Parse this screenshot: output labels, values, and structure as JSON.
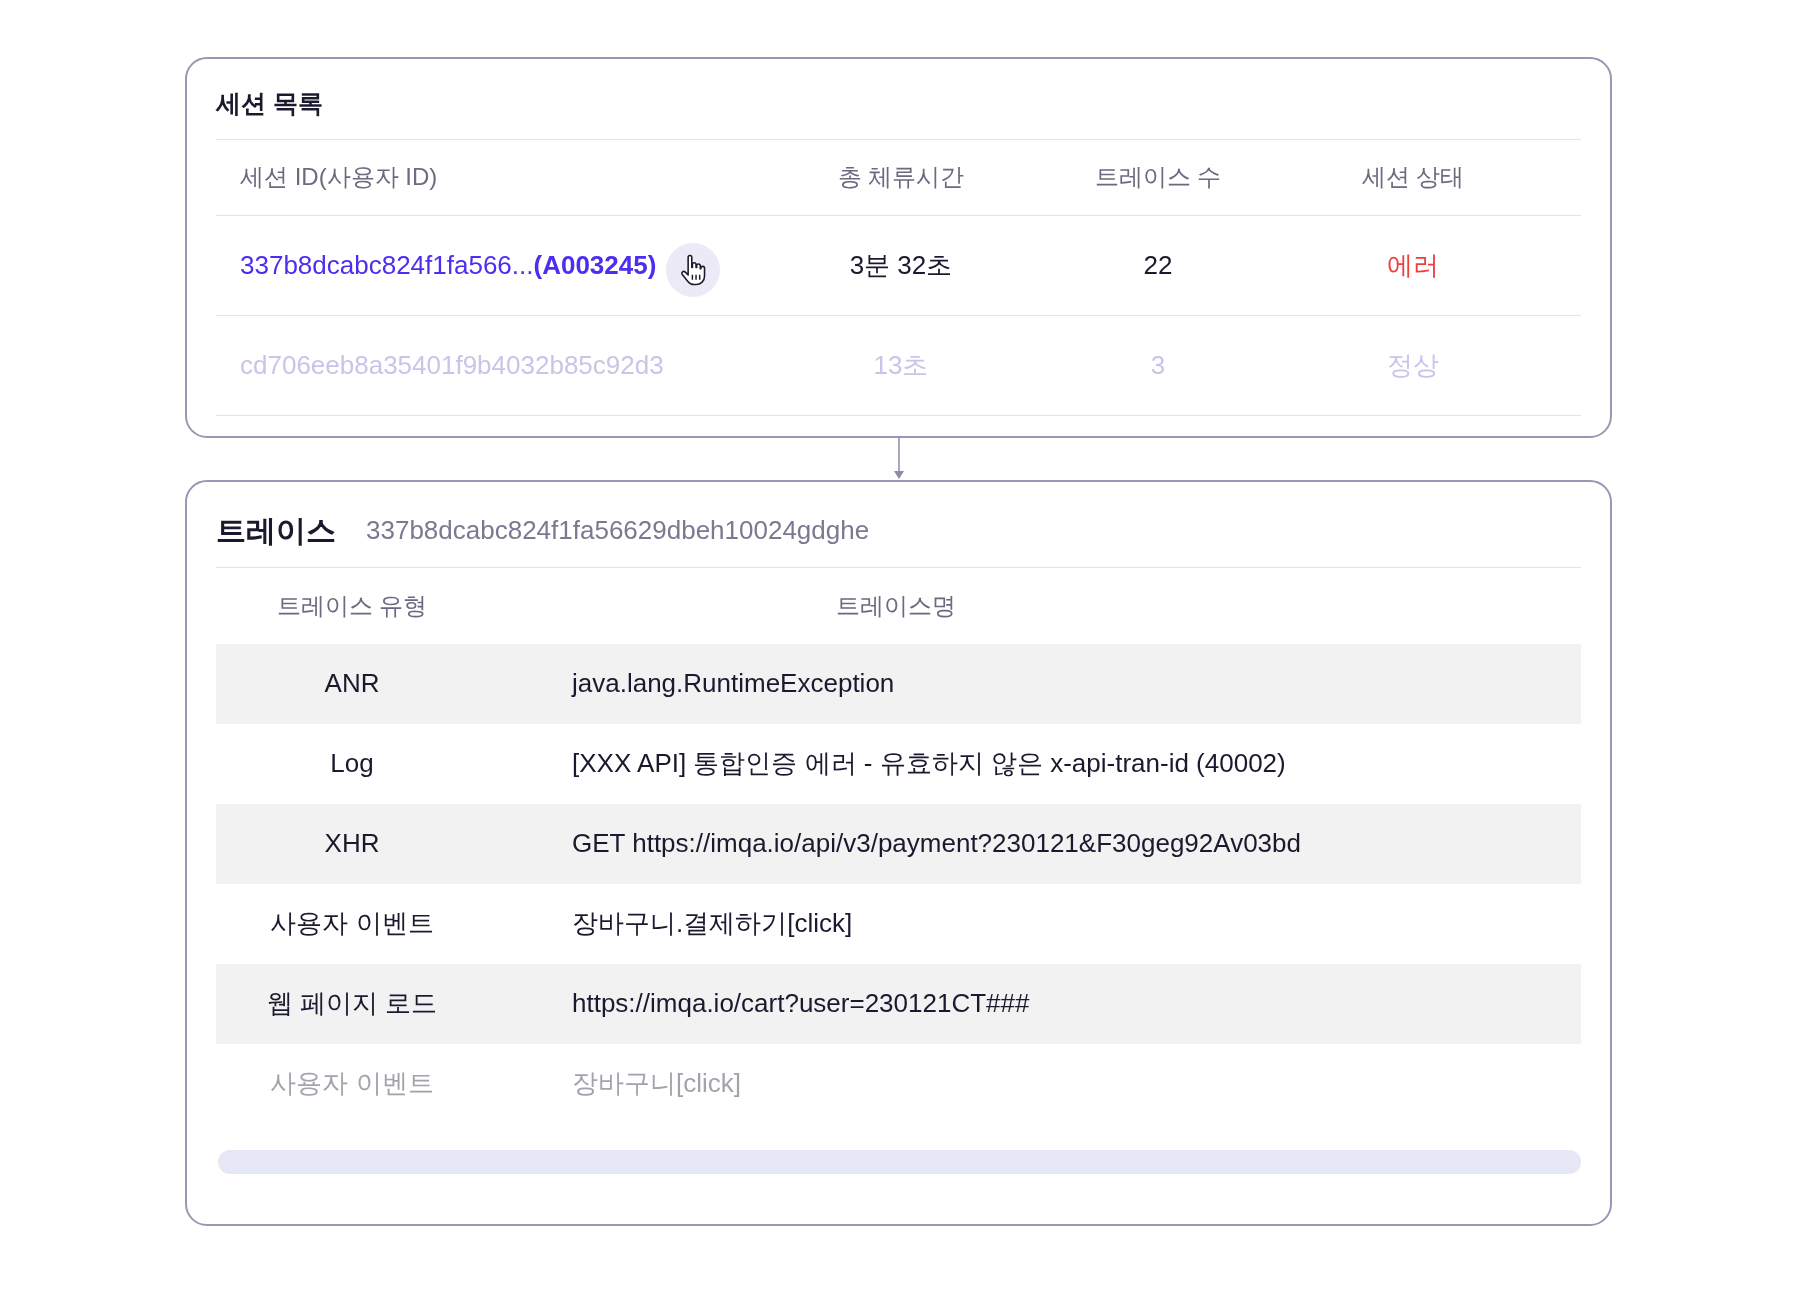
{
  "sessions": {
    "title": "세션 목록",
    "columns": [
      "세션 ID(사용자 ID)",
      "총 체류시간",
      "트레이스 수",
      "세션 상태"
    ],
    "rows": [
      {
        "session_id": "337b8dcabc824f1fa566...**(A003245)**",
        "duration": "3분 32초",
        "trace_count": "22",
        "status": "에러",
        "color": "#f03e3e",
        "selected": true
      },
      {
        "session_id": "cd706eeb8a35401f9b4032b85c92d3",
        "duration": "13초",
        "trace_count": "3",
        "status": "정상",
        "color": "#c9c4e8",
        "selected": false
      }
    ]
  },
  "traces": {
    "title": "트레이스",
    "trace_id": "337b8dcabc824f1fa56629dbeh10024gdghe",
    "columns": [
      "트레이스 유형",
      "트레이스명"
    ],
    "rows": [
      {
        "type": "ANR",
        "name": "java.lang.RuntimeException",
        "dimmed": false
      },
      {
        "type": "Log",
        "name": "[XXX API] 통합인증 에러 - 유효하지 않은 x-api-tran-id (40002)",
        "dimmed": false
      },
      {
        "type": "XHR",
        "name": "GET https://imqa.io/api/v3/payment?230121&F30geg92Av03bd",
        "dimmed": false
      },
      {
        "type": "사용자 이벤트",
        "name": "장바구니.결제하기[click]",
        "dimmed": false
      },
      {
        "type": "웹 페이지 로드",
        "name": "https://imqa.io/cart?user=230121CT###",
        "dimmed": false
      },
      {
        "type": "사용자 이벤트",
        "name": "장바구니[click]",
        "dimmed": true
      }
    ]
  }
}
